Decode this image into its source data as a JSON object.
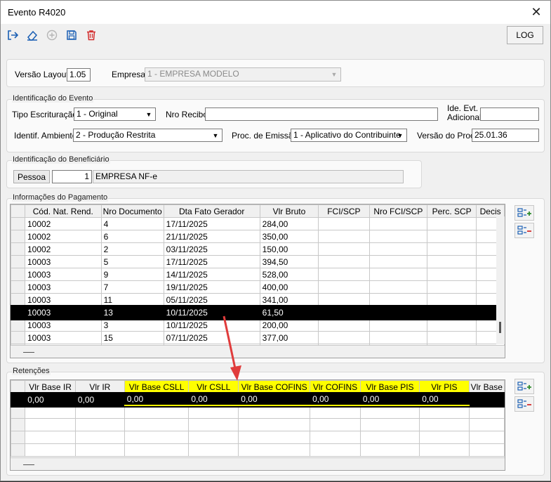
{
  "window": {
    "title": "Evento R4020",
    "close_glyph": "✕"
  },
  "toolbar": {
    "buttons": [
      {
        "name": "exit-icon"
      },
      {
        "name": "eraser-icon"
      },
      {
        "name": "add-circle-icon"
      },
      {
        "name": "save-icon"
      },
      {
        "name": "delete-icon"
      }
    ],
    "log_label": "LOG"
  },
  "top": {
    "versao_label": "Versão Layout",
    "versao_value": "1.05",
    "empresa_label": "Empresa",
    "empresa_value": "1 - EMPRESA MODELO"
  },
  "identificacao": {
    "legend": "Identificação do Evento",
    "tipo_label": "Tipo Escrituração",
    "tipo_value": "1 - Original",
    "nro_recibo_label": "Nro Recibo",
    "nro_recibo_value": "",
    "ide_evt_label_1": "Ide. Evt.",
    "ide_evt_label_2": "Adicional",
    "ide_evt_value": "",
    "ambiente_label": "Identif. Ambiente",
    "ambiente_value": "2 - Produção Restrita",
    "proc_label": "Proc. de Emissão",
    "proc_value": "1 - Aplicativo do Contribuinte",
    "versao_proc_label": "Versão do Proc.",
    "versao_proc_value": "25.01.36"
  },
  "beneficiario": {
    "legend": "Identificação do Beneficiário",
    "pessoa_label": "Pessoa",
    "pessoa_code": "1",
    "pessoa_name": "EMPRESA NF-e"
  },
  "pagamento": {
    "legend": "Informações do Pagamento",
    "columns": [
      "Cód. Nat. Rend.",
      "Nro Documento",
      "Dta Fato Gerador",
      "Vlr Bruto",
      "FCI/SCP",
      "Nro FCI/SCP",
      "Perc. SCP",
      "Decis"
    ],
    "rows": [
      [
        "10002",
        "4",
        "17/11/2025",
        "284,00"
      ],
      [
        "10002",
        "6",
        "21/11/2025",
        "350,00"
      ],
      [
        "10002",
        "2",
        "03/11/2025",
        "150,00"
      ],
      [
        "10003",
        "5",
        "17/11/2025",
        "394,50"
      ],
      [
        "10003",
        "9",
        "14/11/2025",
        "528,00"
      ],
      [
        "10003",
        "7",
        "19/11/2025",
        "400,00"
      ],
      [
        "10003",
        "11",
        "05/11/2025",
        "341,00"
      ],
      [
        "10003",
        "13",
        "10/11/2025",
        "61,50"
      ],
      [
        "10003",
        "3",
        "10/11/2025",
        "200,00"
      ],
      [
        "10003",
        "15",
        "07/11/2025",
        "377,00"
      ]
    ],
    "selected_row": 7
  },
  "retencoes": {
    "legend": "Retenções",
    "columns": [
      "Vlr Base IR",
      "Vlr IR",
      "Vlr Base CSLL",
      "Vlr CSLL",
      "Vlr Base COFINS",
      "Vlr COFINS",
      "Vlr Base PIS",
      "Vlr PIS",
      "Vlr Base"
    ],
    "highlight_cols": [
      2,
      3,
      4,
      5,
      6,
      7
    ],
    "highlight_color": "#ffff00",
    "row": [
      "0,00",
      "0,00",
      "0,00",
      "0,00",
      "0,00",
      "0,00",
      "0,00",
      "0,00",
      ""
    ]
  },
  "colors": {
    "selection": "#000000",
    "annotation_arrow": "#e03c3c",
    "delete_red": "#d32f2f",
    "accent_blue": "#1a5fb4"
  }
}
